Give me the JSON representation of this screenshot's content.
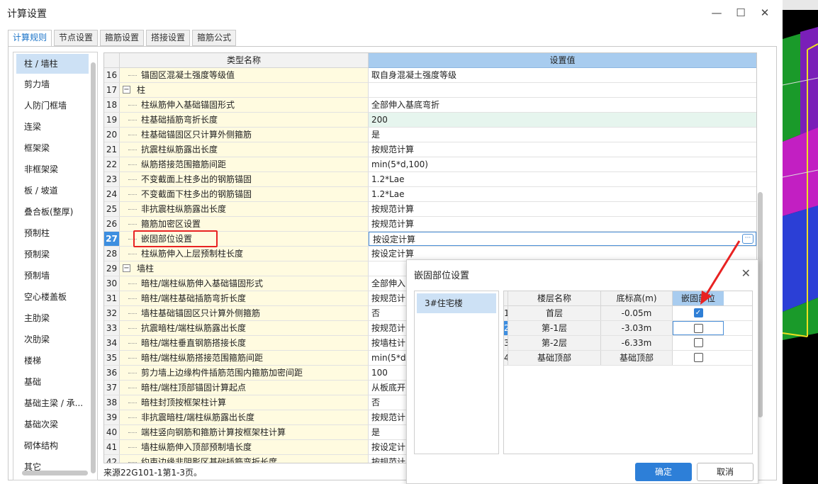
{
  "window": {
    "title": "计算设置",
    "min_label": "—",
    "max_label": "☐",
    "close_label": "✕"
  },
  "tabs": [
    {
      "label": "计算规则",
      "active": true
    },
    {
      "label": "节点设置"
    },
    {
      "label": "箍筋设置"
    },
    {
      "label": "搭接设置"
    },
    {
      "label": "箍筋公式"
    }
  ],
  "sidebar": {
    "items": [
      "柱 / 墙柱",
      "剪力墙",
      "人防门框墙",
      "连梁",
      "框架梁",
      "非框架梁",
      "板 / 坡道",
      "叠合板(整厚)",
      "预制柱",
      "预制梁",
      "预制墙",
      "空心楼盖板",
      "主肋梁",
      "次肋梁",
      "楼梯",
      "基础",
      "基础主梁 / 承...",
      "基础次梁",
      "砌体结构",
      "其它"
    ]
  },
  "grid": {
    "header_name": "类型名称",
    "header_value": "设置值",
    "rows": [
      {
        "num": "16",
        "name": "锚固区混凝土强度等级值",
        "value": "取自身混凝土强度等级"
      },
      {
        "num": "17",
        "name": "柱",
        "value": "",
        "group": true
      },
      {
        "num": "18",
        "name": "柱纵筋伸入基础锚固形式",
        "value": "全部伸入基底弯折"
      },
      {
        "num": "19",
        "name": "柱基础插筋弯折长度",
        "value": "200",
        "highlight": true
      },
      {
        "num": "20",
        "name": "柱基础锚固区只计算外侧箍筋",
        "value": "是"
      },
      {
        "num": "21",
        "name": "抗震柱纵筋露出长度",
        "value": "按规范计算"
      },
      {
        "num": "22",
        "name": "纵筋搭接范围箍筋间距",
        "value": "min(5*d,100)"
      },
      {
        "num": "23",
        "name": "不变截面上柱多出的钢筋锚固",
        "value": "1.2*Lae"
      },
      {
        "num": "24",
        "name": "不变截面下柱多出的钢筋锚固",
        "value": "1.2*Lae"
      },
      {
        "num": "25",
        "name": "非抗震柱纵筋露出长度",
        "value": "按规范计算"
      },
      {
        "num": "26",
        "name": "箍筋加密区设置",
        "value": "按规范计算"
      },
      {
        "num": "27",
        "name": "嵌固部位设置",
        "value": "按设定计算",
        "selected": true
      },
      {
        "num": "28",
        "name": "柱纵筋伸入上层预制柱长度",
        "value": "按设定计算"
      },
      {
        "num": "29",
        "name": "墙柱",
        "value": "",
        "group": true
      },
      {
        "num": "30",
        "name": "暗柱/端柱纵筋伸入基础锚固形式",
        "value": "全部伸入"
      },
      {
        "num": "31",
        "name": "暗柱/端柱基础插筋弯折长度",
        "value": "按规范计"
      },
      {
        "num": "32",
        "name": "墙柱基础锚固区只计算外侧箍筋",
        "value": "否"
      },
      {
        "num": "33",
        "name": "抗震暗柱/端柱纵筋露出长度",
        "value": "按规范计"
      },
      {
        "num": "34",
        "name": "暗柱/端柱垂直钢筋搭接长度",
        "value": "按墙柱计"
      },
      {
        "num": "35",
        "name": "暗柱/端柱纵筋搭接范围箍筋间距",
        "value": "min(5*d,"
      },
      {
        "num": "36",
        "name": "剪力墙上边缘构件插筋范围内箍筋加密间距",
        "value": "100"
      },
      {
        "num": "37",
        "name": "暗柱/端柱顶部锚固计算起点",
        "value": "从板底开"
      },
      {
        "num": "38",
        "name": "暗柱封顶按框架柱计算",
        "value": "否"
      },
      {
        "num": "39",
        "name": "非抗震暗柱/端柱纵筋露出长度",
        "value": "按规范计"
      },
      {
        "num": "40",
        "name": "端柱竖向钢筋和箍筋计算按框架柱计算",
        "value": "是"
      },
      {
        "num": "41",
        "name": "墙柱纵筋伸入顶部预制墙长度",
        "value": "按设定计"
      },
      {
        "num": "42",
        "name": "约束边缘非阴影区基础插筋弯折长度",
        "value": "按规范计"
      }
    ]
  },
  "footer_note": "来源22G101-1第1-3页。",
  "dialog": {
    "title": "嵌固部位设置",
    "close_label": "✕",
    "buildings": [
      "3#住宅楼"
    ],
    "col_floor": "楼层名称",
    "col_elev": "底标高(m)",
    "col_embed": "嵌固部位",
    "floors": [
      {
        "idx": "1",
        "name": "首层",
        "elev": "-0.05m",
        "checked": true
      },
      {
        "idx": "2",
        "name": "第-1层",
        "elev": "-3.03m",
        "checked": false,
        "selected": true
      },
      {
        "idx": "3",
        "name": "第-2层",
        "elev": "-6.33m",
        "checked": false
      },
      {
        "idx": "4",
        "name": "基础顶部",
        "elev": "基础顶部",
        "checked": false
      }
    ],
    "ok_label": "确定",
    "cancel_label": "取消"
  },
  "colors": {
    "accent": "#2d7fd8",
    "header_blue": "#a8ccef",
    "name_bg": "#fffbe0",
    "annotation_red": "#e82222"
  }
}
